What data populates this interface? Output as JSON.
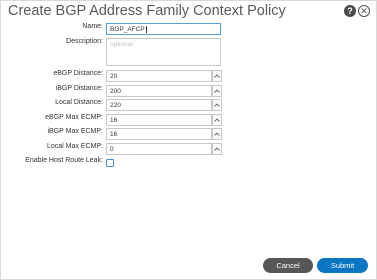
{
  "dialog": {
    "title": "Create BGP Address Family Context Policy",
    "help_icon_glyph": "?",
    "close_icon_glyph": "✕"
  },
  "form": {
    "name": {
      "label": "Name:",
      "value": "BGP_AFCP"
    },
    "description": {
      "label": "Description:",
      "placeholder": "optional"
    },
    "ebgp_distance": {
      "label": "eBGP Distance:",
      "value": "20"
    },
    "ibgp_distance": {
      "label": "iBGP Distance:",
      "value": "200"
    },
    "local_distance": {
      "label": "Local Distance:",
      "value": "220"
    },
    "ebgp_max_ecmp": {
      "label": "eBGP Max ECMP:",
      "value": "16"
    },
    "ibgp_max_ecmp": {
      "label": "iBGP Max ECMP:",
      "value": "16"
    },
    "local_max_ecmp": {
      "label": "Local Max ECMP:",
      "value": "0"
    },
    "enable_host_route_leak": {
      "label": "Enable Host Route Leak:",
      "checked": false
    }
  },
  "buttons": {
    "cancel": "Cancel",
    "submit": "Submit"
  },
  "colors": {
    "submit": "#0a75c2",
    "cancel": "#575757",
    "focus_border": "#5aa0d8"
  }
}
